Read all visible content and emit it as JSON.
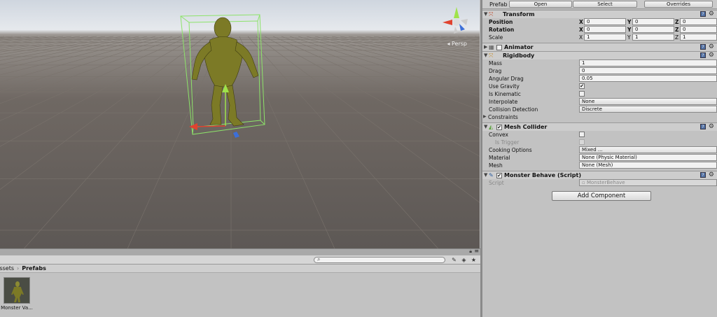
{
  "scene": {
    "persp_label": "Persp",
    "colors": {
      "grid": "#7a736d",
      "bounds": "#8de36a",
      "x_axis": "#e0432f",
      "y_axis": "#9fe34a",
      "z_axis": "#3c6fd8",
      "model": "#7c7a26"
    }
  },
  "project": {
    "breadcrumb": {
      "root": "Assets",
      "sep": "›",
      "current": "Prefabs"
    },
    "search_icon": "magnifier-icon",
    "asset": {
      "label": "Monster Va...",
      "icon": "monster-prefab-thumbnail"
    }
  },
  "inspector": {
    "prefab": {
      "label": "Prefab",
      "open": "Open",
      "select": "Select",
      "overrides": "Overrides"
    },
    "transform": {
      "title": "Transform",
      "position": {
        "label": "Position",
        "x": "0",
        "y": "0",
        "z": "0"
      },
      "rotation": {
        "label": "Rotation",
        "x": "0",
        "y": "0",
        "z": "0"
      },
      "scale": {
        "label": "Scale",
        "x": "1",
        "y": "1",
        "z": "1"
      }
    },
    "axes": {
      "x": "X",
      "y": "Y",
      "z": "Z"
    },
    "animator": {
      "title": "Animator"
    },
    "rigidbody": {
      "title": "Rigidbody",
      "mass": {
        "label": "Mass",
        "value": "1"
      },
      "drag": {
        "label": "Drag",
        "value": "0"
      },
      "angular_drag": {
        "label": "Angular Drag",
        "value": "0.05"
      },
      "use_gravity": {
        "label": "Use Gravity",
        "checked": true
      },
      "is_kinematic": {
        "label": "Is Kinematic",
        "checked": false
      },
      "interpolate": {
        "label": "Interpolate",
        "value": "None"
      },
      "collision_detection": {
        "label": "Collision Detection",
        "value": "Discrete"
      },
      "constraints": {
        "label": "Constraints"
      }
    },
    "mesh_collider": {
      "title": "Mesh Collider",
      "convex": {
        "label": "Convex"
      },
      "is_trigger": {
        "label": "Is Trigger"
      },
      "cooking_options": {
        "label": "Cooking Options",
        "value": "Mixed ..."
      },
      "material": {
        "label": "Material",
        "value": "None (Physic Material)"
      },
      "mesh": {
        "label": "Mesh",
        "value": "None (Mesh)"
      }
    },
    "script_comp": {
      "title": "Monster Behave (Script)",
      "script": {
        "label": "Script",
        "value": "MonsterBehave"
      }
    },
    "add_component": "Add Component",
    "check_glyph": "✔",
    "help_glyph": "?",
    "gear_glyph": "⚙"
  }
}
